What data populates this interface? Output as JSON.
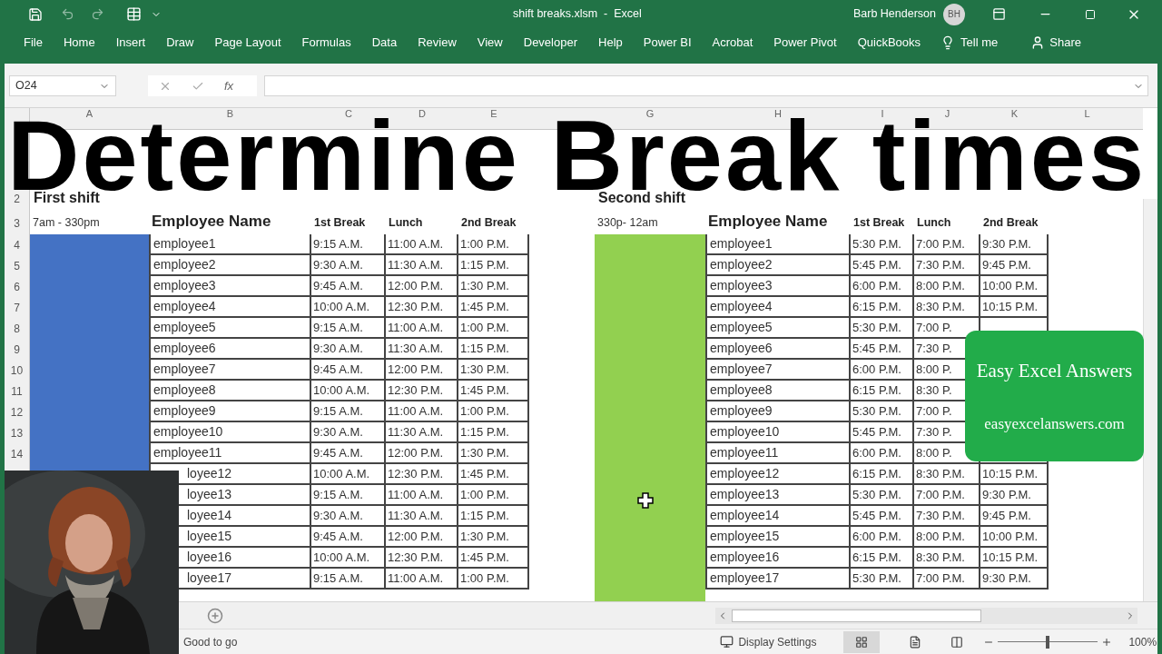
{
  "title_bar": {
    "title": "shift breaks.xlsm  -  Excel",
    "user": "Barb Henderson",
    "initials": "BH"
  },
  "ribbon_tabs": [
    "File",
    "Home",
    "Insert",
    "Draw",
    "Page Layout",
    "Formulas",
    "Data",
    "Review",
    "View",
    "Developer",
    "Help",
    "Power BI",
    "Acrobat",
    "Power Pivot",
    "QuickBooks"
  ],
  "tell_me": "Tell me",
  "share": "Share",
  "formula_bar": {
    "name_box": "O24",
    "function_label": "fx"
  },
  "overlay_title": "Determine Break times",
  "column_headers": [
    "A",
    "B",
    "C",
    "D",
    "E",
    "G",
    "H",
    "I",
    "J",
    "K",
    "L"
  ],
  "row_numbers": [
    "2",
    "3",
    "4",
    "5",
    "6",
    "7",
    "8",
    "9",
    "10",
    "11",
    "12",
    "13",
    "14"
  ],
  "shifts": [
    {
      "title": "First shift",
      "hours": "7am - 330pm",
      "color": "#4472c4",
      "headers": [
        "Employee Name",
        "1st Break",
        "Lunch",
        "2nd Break"
      ],
      "rows": [
        {
          "name": "employee1",
          "times": [
            "9:15 A.M.",
            "11:00 A.M.",
            "1:00 P.M."
          ]
        },
        {
          "name": "employee2",
          "times": [
            "9:30 A.M.",
            "11:30 A.M.",
            "1:15 P.M."
          ]
        },
        {
          "name": "employee3",
          "times": [
            "9:45 A.M.",
            "12:00 P.M.",
            "1:30 P.M."
          ]
        },
        {
          "name": "employee4",
          "times": [
            "10:00 A.M.",
            "12:30 P.M.",
            "1:45 P.M."
          ]
        },
        {
          "name": "employee5",
          "times": [
            "9:15 A.M.",
            "11:00 A.M.",
            "1:00 P.M."
          ]
        },
        {
          "name": "employee6",
          "times": [
            "9:30 A.M.",
            "11:30 A.M.",
            "1:15 P.M."
          ]
        },
        {
          "name": "employee7",
          "times": [
            "9:45 A.M.",
            "12:00 P.M.",
            "1:30 P.M."
          ]
        },
        {
          "name": "employee8",
          "times": [
            "10:00 A.M.",
            "12:30 P.M.",
            "1:45 P.M."
          ]
        },
        {
          "name": "employee9",
          "times": [
            "9:15 A.M.",
            "11:00 A.M.",
            "1:00 P.M."
          ]
        },
        {
          "name": "employee10",
          "times": [
            "9:30 A.M.",
            "11:30 A.M.",
            "1:15 P.M."
          ]
        },
        {
          "name": "employee11",
          "times": [
            "9:45 A.M.",
            "12:00 P.M.",
            "1:30 P.M."
          ]
        },
        {
          "name": "loyee12",
          "times": [
            "10:00 A.M.",
            "12:30 P.M.",
            "1:45 P.M."
          ]
        },
        {
          "name": "loyee13",
          "times": [
            "9:15 A.M.",
            "11:00 A.M.",
            "1:00 P.M."
          ]
        },
        {
          "name": "loyee14",
          "times": [
            "9:30 A.M.",
            "11:30 A.M.",
            "1:15 P.M."
          ]
        },
        {
          "name": "loyee15",
          "times": [
            "9:45 A.M.",
            "12:00 P.M.",
            "1:30 P.M."
          ]
        },
        {
          "name": "loyee16",
          "times": [
            "10:00 A.M.",
            "12:30 P.M.",
            "1:45 P.M."
          ]
        },
        {
          "name": "loyee17",
          "times": [
            "9:15 A.M.",
            "11:00 A.M.",
            "1:00 P.M."
          ]
        }
      ]
    },
    {
      "title": "Second shift",
      "hours": "330p- 12am",
      "color": "#92d050",
      "headers": [
        "Employee Name",
        "1st Break",
        "Lunch",
        "2nd Break"
      ],
      "rows": [
        {
          "name": "employee1",
          "times": [
            "5:30 P.M.",
            "7:00 P.M.",
            "9:30 P.M."
          ]
        },
        {
          "name": "employee2",
          "times": [
            "5:45 P.M.",
            "7:30 P.M.",
            "9:45 P.M."
          ]
        },
        {
          "name": "employee3",
          "times": [
            "6:00 P.M.",
            "8:00 P.M.",
            "10:00 P.M."
          ]
        },
        {
          "name": "employee4",
          "times": [
            "6:15 P.M.",
            "8:30 P.M.",
            "10:15 P.M."
          ]
        },
        {
          "name": "employee5",
          "times": [
            "5:30 P.M.",
            "7:00 P."
          ]
        },
        {
          "name": "employee6",
          "times": [
            "5:45 P.M.",
            "7:30 P."
          ]
        },
        {
          "name": "employee7",
          "times": [
            "6:00 P.M.",
            "8:00 P."
          ]
        },
        {
          "name": "employee8",
          "times": [
            "6:15 P.M.",
            "8:30 P."
          ]
        },
        {
          "name": "employee9",
          "times": [
            "5:30 P.M.",
            "7:00 P."
          ]
        },
        {
          "name": "employee10",
          "times": [
            "5:45 P.M.",
            "7:30 P."
          ]
        },
        {
          "name": "employee11",
          "times": [
            "6:00 P.M.",
            "8:00 P."
          ]
        },
        {
          "name": "employee12",
          "times": [
            "6:15 P.M.",
            "8:30 P.M.",
            "10:15 P.M."
          ]
        },
        {
          "name": "employee13",
          "times": [
            "5:30 P.M.",
            "7:00 P.M.",
            "9:30 P.M."
          ]
        },
        {
          "name": "employee14",
          "times": [
            "5:45 P.M.",
            "7:30 P.M.",
            "9:45 P.M."
          ]
        },
        {
          "name": "employee15",
          "times": [
            "6:00 P.M.",
            "8:00 P.M.",
            "10:00 P.M."
          ]
        },
        {
          "name": "employee16",
          "times": [
            "6:15 P.M.",
            "8:30 P.M.",
            "10:15 P.M."
          ]
        },
        {
          "name": "employee17",
          "times": [
            "5:30 P.M.",
            "7:00 P.M.",
            "9:30 P.M."
          ]
        }
      ]
    }
  ],
  "badge": {
    "title": "Easy Excel Answers",
    "url": "easyexcelanswers.com"
  },
  "status_bar": {
    "status": "Good to go",
    "display_settings": "Display Settings",
    "zoom": "100%",
    "zoom_slider": {
      "level": 0.5
    }
  }
}
